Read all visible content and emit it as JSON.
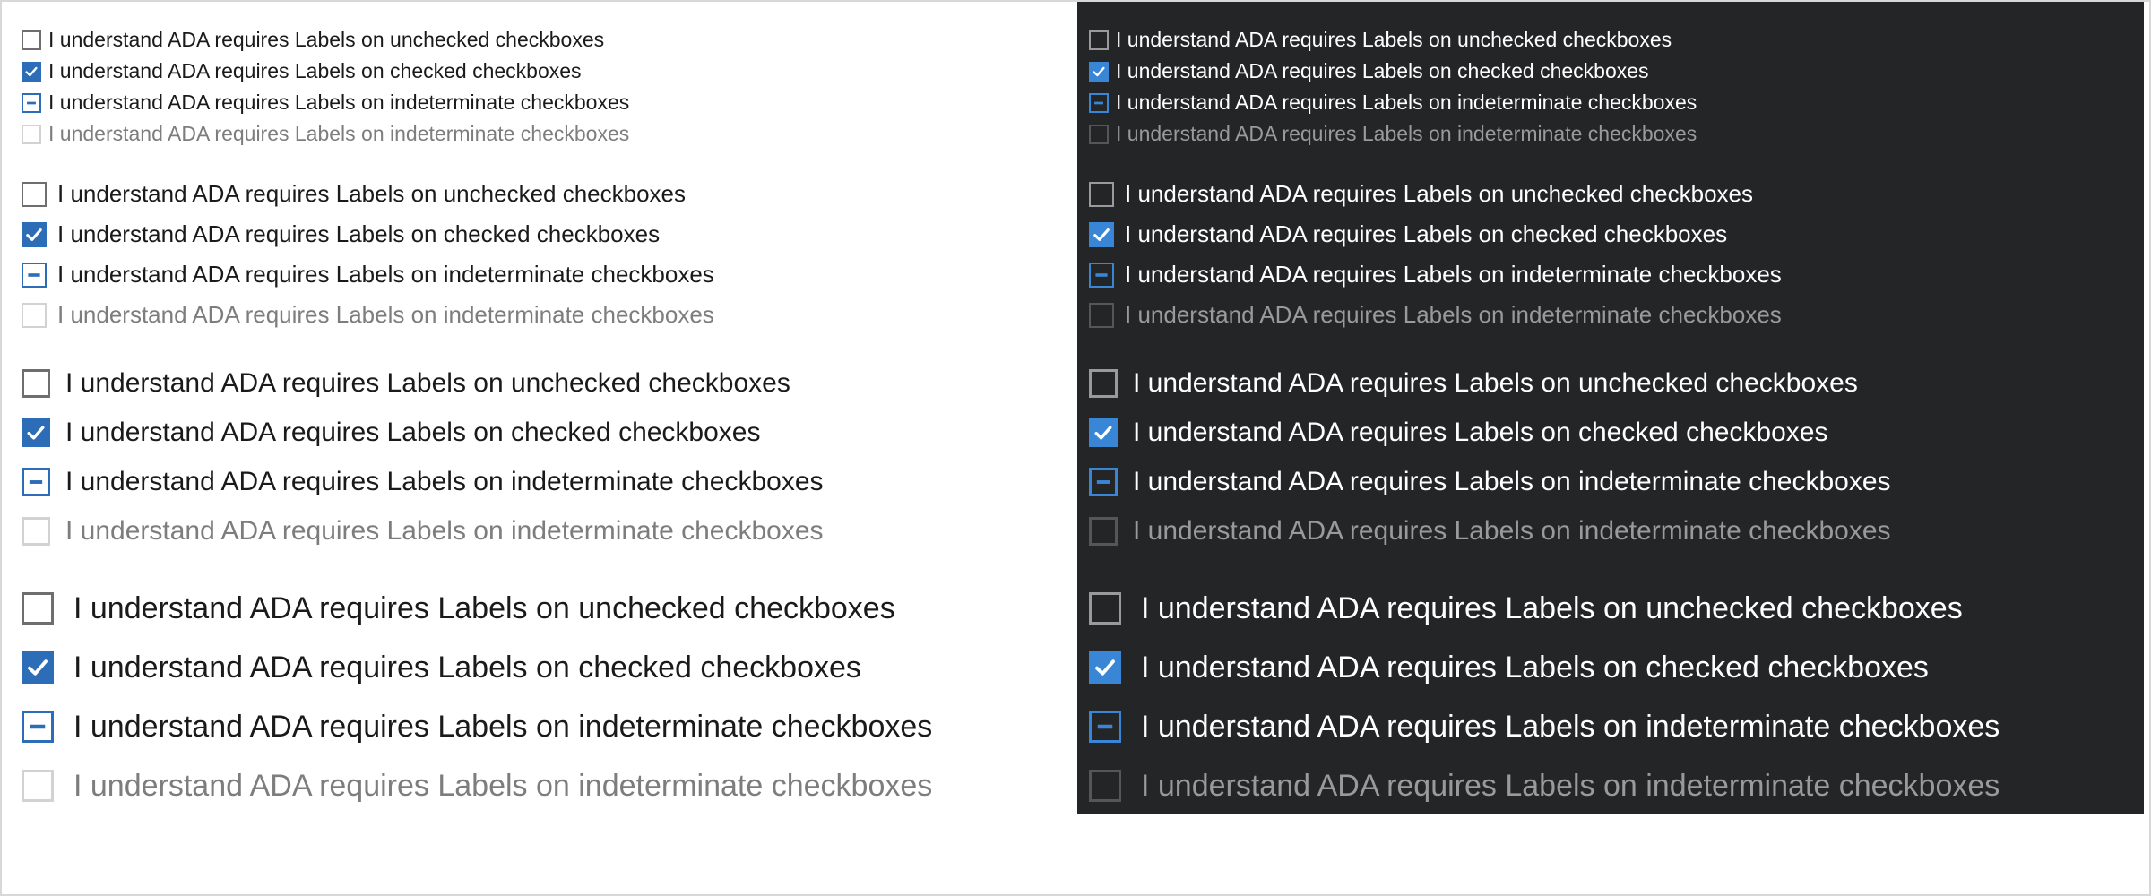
{
  "labels": {
    "unchecked": "I understand ADA requires Labels on unchecked checkboxes",
    "checked": "I understand ADA requires Labels on checked checkboxes",
    "indeterminate": "I understand ADA requires Labels on indeterminate checkboxes",
    "disabled": "I understand ADA requires Labels on indeterminate checkboxes"
  },
  "states": [
    "unchecked",
    "checked",
    "indeterminate",
    "disabled"
  ],
  "themes": [
    "light",
    "dark"
  ],
  "sizes": [
    "small",
    "medium",
    "large",
    "xlarge"
  ],
  "colors": {
    "accent_light": "#2d6db8",
    "accent_dark": "#3a86d6",
    "dark_background": "#242526"
  },
  "icons": {
    "checked": "checkmark-icon",
    "indeterminate": "dash-icon"
  }
}
